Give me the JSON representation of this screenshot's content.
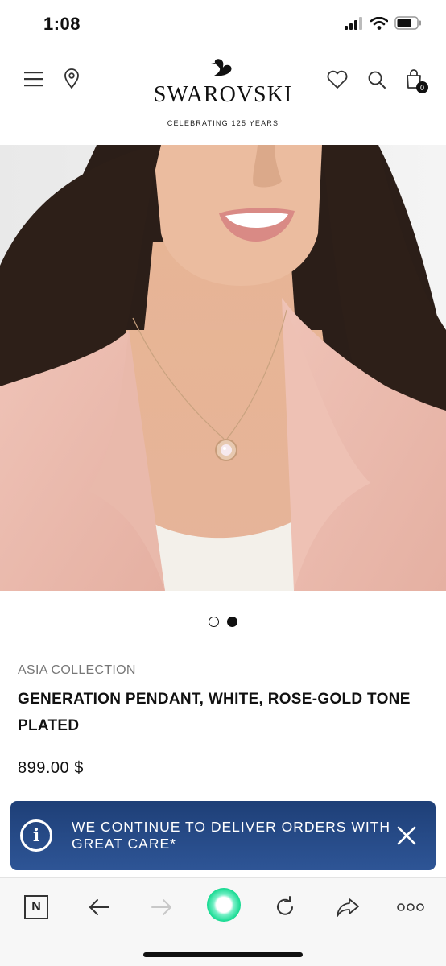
{
  "status": {
    "time": "1:08"
  },
  "header": {
    "brand": "SWAROVSKI",
    "tagline": "CELEBRATING 125 YEARS",
    "cart_count": "0"
  },
  "carousel": {
    "total": 2,
    "active_index": 1
  },
  "product": {
    "collection": "ASIA COLLECTION",
    "name": "GENERATION PENDANT, WHITE, ROSE-GOLD TONE PLATED",
    "price": "899.00 $"
  },
  "banner": {
    "message": "WE CONTINUE TO DELIVER ORDERS WITH GREAT CARE*",
    "bg_color": "#2a4e8e"
  },
  "browser_toolbar": {
    "items": [
      "tabs-n-icon",
      "back-arrow-icon",
      "forward-arrow-icon",
      "home-orb-icon",
      "reload-icon",
      "share-icon",
      "more-icon"
    ]
  }
}
